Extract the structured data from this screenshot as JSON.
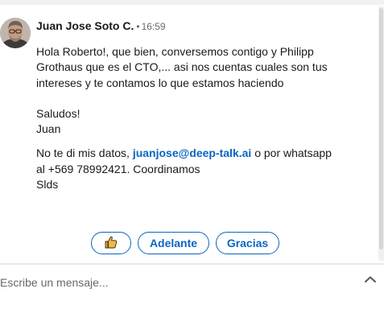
{
  "message": {
    "sender": "Juan Jose Soto C.",
    "separator": "•",
    "time": "16:59",
    "paragraph1": "Hola Roberto!, que bien, conversemos contigo y Philipp Grothaus que es el CTO,... asi nos cuentas cuales son tus intereses y te contamos lo que estamos haciendo",
    "greeting": "Saludos!",
    "signature": "Juan",
    "p3_before_link": "No te di mis datos, ",
    "email": "juanjose@deep-talk.ai",
    "p3_after_link": " o por whatsapp al +569 78992421. Coordinamos",
    "closing": "Slds"
  },
  "quick_replies": {
    "thumbs_up_icon": "thumbs-up-icon",
    "adelante": "Adelante",
    "gracias": "Gracias"
  },
  "composer": {
    "placeholder": "Escribe un mensaje...",
    "expand_icon": "chevron-up-icon"
  },
  "colors": {
    "accent": "#0a66c2",
    "thumb_yellow": "#e7a33e"
  }
}
